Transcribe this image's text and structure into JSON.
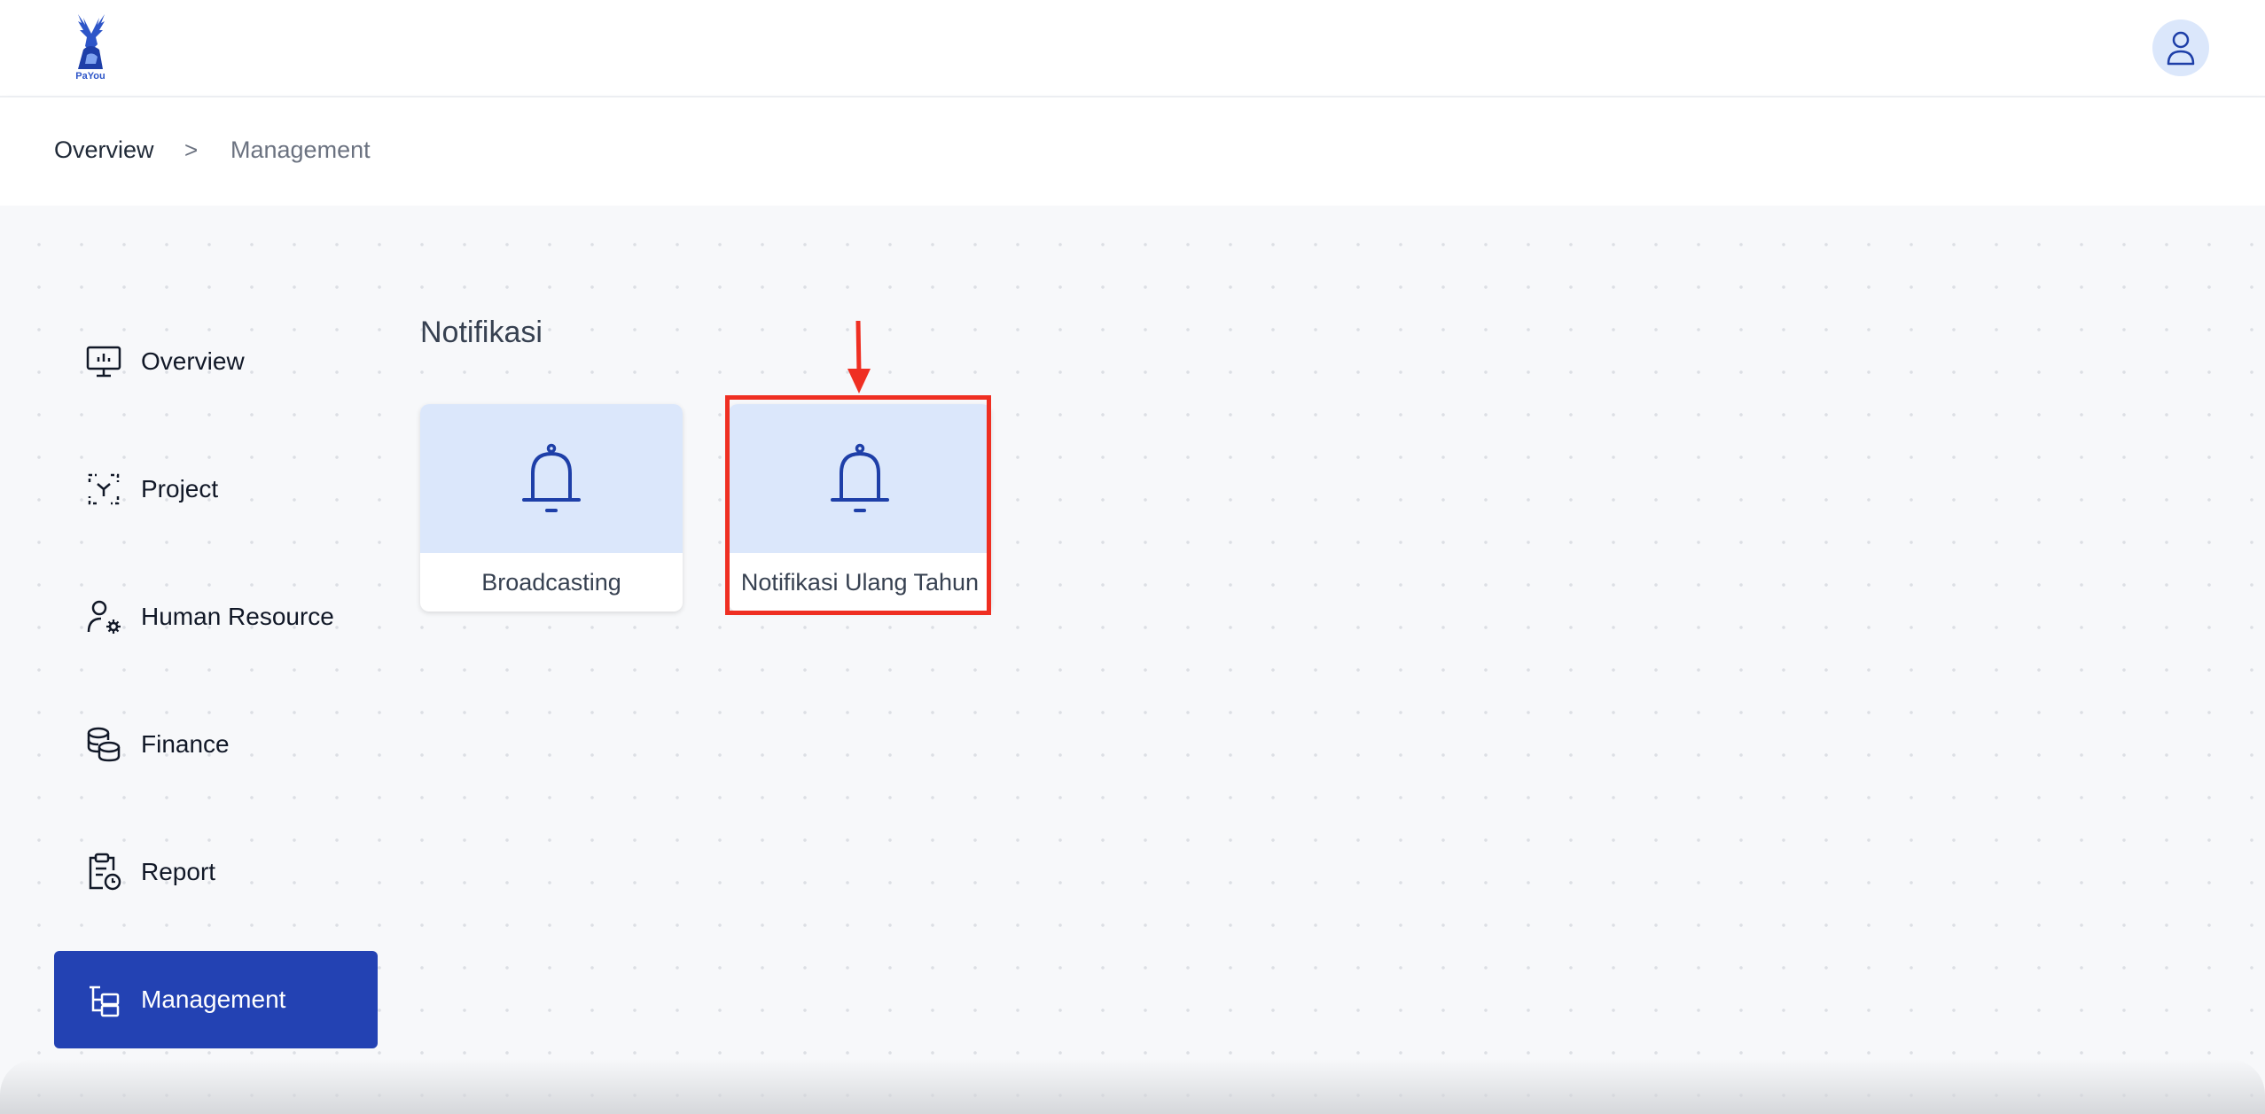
{
  "header": {
    "logo_text": "PaYou",
    "avatar_icon": "user-icon"
  },
  "breadcrumb": {
    "items": [
      "Overview",
      "Management"
    ],
    "separator": ">"
  },
  "sidebar": {
    "items": [
      {
        "label": "Overview",
        "icon": "presentation-chart-icon",
        "active": false
      },
      {
        "label": "Project",
        "icon": "project-scan-icon",
        "active": false
      },
      {
        "label": "Human Resource",
        "icon": "user-gear-icon",
        "active": false
      },
      {
        "label": "Finance",
        "icon": "coins-stack-icon",
        "active": false
      },
      {
        "label": "Report",
        "icon": "clipboard-clock-icon",
        "active": false
      },
      {
        "label": "Management",
        "icon": "hierarchy-icon",
        "active": true
      }
    ],
    "active_color": "#2342b3"
  },
  "main": {
    "section_title": "Notifikasi",
    "cards": [
      {
        "label": "Broadcasting",
        "icon": "bell-icon"
      },
      {
        "label": "Notifikasi Ulang Tahun",
        "icon": "bell-icon"
      }
    ],
    "card_bg": "#dbe7fb",
    "icon_color": "#1e3fa8"
  },
  "annotation": {
    "highlight_color": "#ef2f22"
  }
}
